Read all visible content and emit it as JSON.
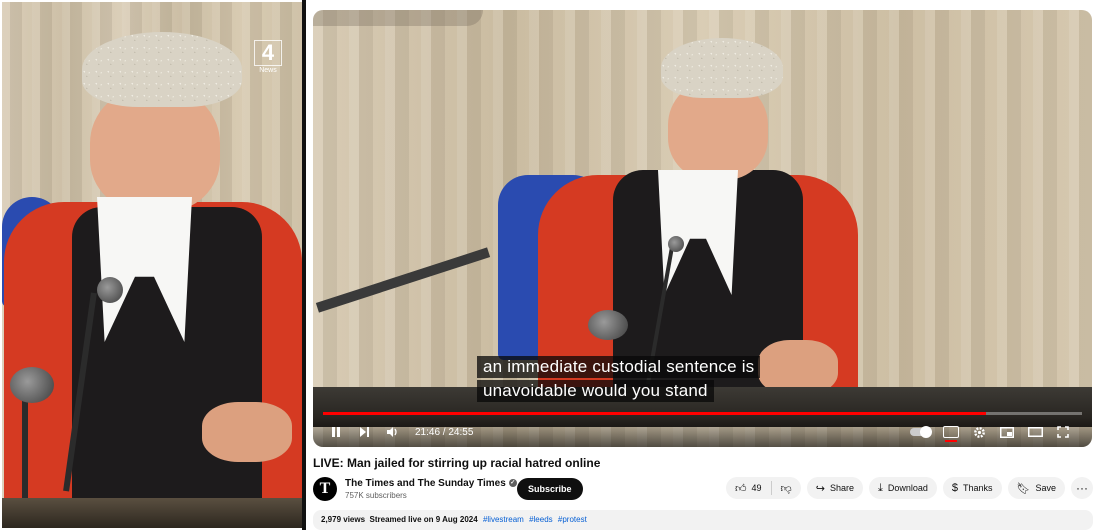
{
  "left_panel": {
    "logo_number": "4",
    "logo_text": "News"
  },
  "player": {
    "subtitle_lines": [
      "an immediate custodial sentence is",
      "unavoidable would you stand"
    ],
    "current_time": "21:46",
    "duration": "24:55",
    "progress": 0.873,
    "time_display": "21:46 / 24:55",
    "icons": {
      "play_pause": "pause-icon",
      "next": "next-icon",
      "volume": "volume-icon",
      "autoplay": "autoplay-toggle-icon",
      "captions": "captions-icon",
      "settings": "gear-icon",
      "miniplayer": "miniplayer-icon",
      "theater": "theater-icon",
      "fullscreen": "fullscreen-icon"
    },
    "accent_color": "#ff0000"
  },
  "video": {
    "title": "LIVE: Man jailed for stirring up racial hatred online",
    "channel_name": "The Times and The Sunday Times",
    "avatar_letter": "T",
    "subscribers": "757K subscribers",
    "subscribe_label": "Subscribe",
    "likes": "49",
    "share_label": "Share",
    "download_label": "Download",
    "thanks_label": "Thanks",
    "save_label": "Save",
    "more_label": "···"
  },
  "description": {
    "views": "2,979 views",
    "streamed": "Streamed live on 9 Aug 2024",
    "hashtags": [
      "#livestream",
      "#leeds",
      "#protest"
    ]
  }
}
